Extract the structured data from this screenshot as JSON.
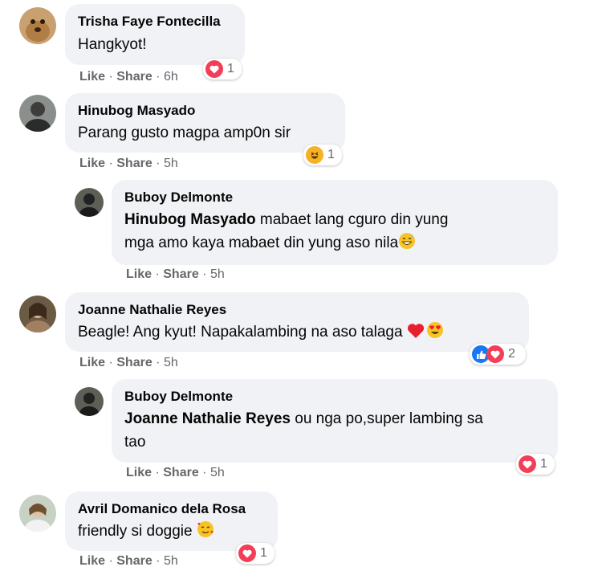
{
  "actions": {
    "like": "Like",
    "share": "Share",
    "sep": "·"
  },
  "comments": [
    {
      "author": "Trisha Faye Fontecilla",
      "text": "Hangkyot!",
      "time": "6h",
      "reactions": {
        "icons": [
          "love"
        ],
        "count": "1"
      }
    },
    {
      "author": "Hinubog Masyado",
      "text": "Parang gusto magpa amp0n sir",
      "time": "5h",
      "reactions": {
        "icons": [
          "haha"
        ],
        "count": "1"
      }
    },
    {
      "author": "Buboy Delmonte",
      "mention": "Hinubog Masyado",
      "text_line1": " mabaet lang cguro din yung",
      "text_line2": "mga amo kaya mabaet din yung aso nila",
      "trailing_emoji": "grinning-sweat-emoji",
      "time": "5h"
    },
    {
      "author": "Joanne Nathalie Reyes",
      "text": "Beagle! Ang kyut! Napakalambing na aso talaga ",
      "trailing_emojis": [
        "red-heart-emoji",
        "heart-eyes-emoji"
      ],
      "time": "5h",
      "reactions": {
        "icons": [
          "like",
          "love"
        ],
        "count": "2"
      }
    },
    {
      "author": "Buboy Delmonte",
      "mention": "Joanne Nathalie Reyes",
      "text_line1": " ou nga po,super lambing sa",
      "text_line2": "tao",
      "time": "5h",
      "reactions": {
        "icons": [
          "love"
        ],
        "count": "1"
      }
    },
    {
      "author": "Avril Domanico dela Rosa",
      "text": "friendly si doggie ",
      "trailing_emoji": "smiling-face-with-hearts-emoji",
      "time": "5h",
      "reactions": {
        "icons": [
          "love"
        ],
        "count": "1"
      }
    }
  ],
  "colors": {
    "bubble": "#f0f2f5",
    "meta": "#65676b",
    "love": "#f33e58",
    "like": "#1877f2",
    "haha": "#f7b125"
  }
}
